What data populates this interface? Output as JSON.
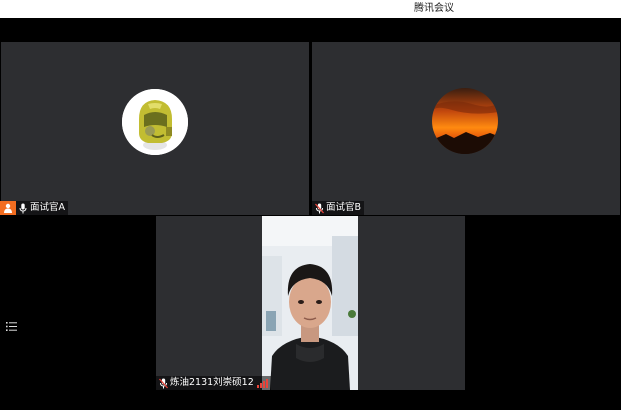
{
  "window": {
    "title": "腾讯会议"
  },
  "participants": [
    {
      "id": "a",
      "name": "面试官A",
      "is_host": true,
      "mic": "on"
    },
    {
      "id": "b",
      "name": "面试官B",
      "is_host": false,
      "mic": "muted"
    },
    {
      "id": "c",
      "name": "炼油2131刘崇硕12",
      "is_host": false,
      "mic": "muted",
      "video": "on",
      "signal_color": "#e8443a"
    }
  ],
  "icons": {
    "host": "host-person-icon",
    "mic": "microphone-icon",
    "list": "member-list-icon",
    "signal": "signal-strength-icon"
  },
  "colors": {
    "tile_bg": "#2d2e31",
    "host_badge": "#f26d21",
    "stage_bg": "#000000"
  }
}
